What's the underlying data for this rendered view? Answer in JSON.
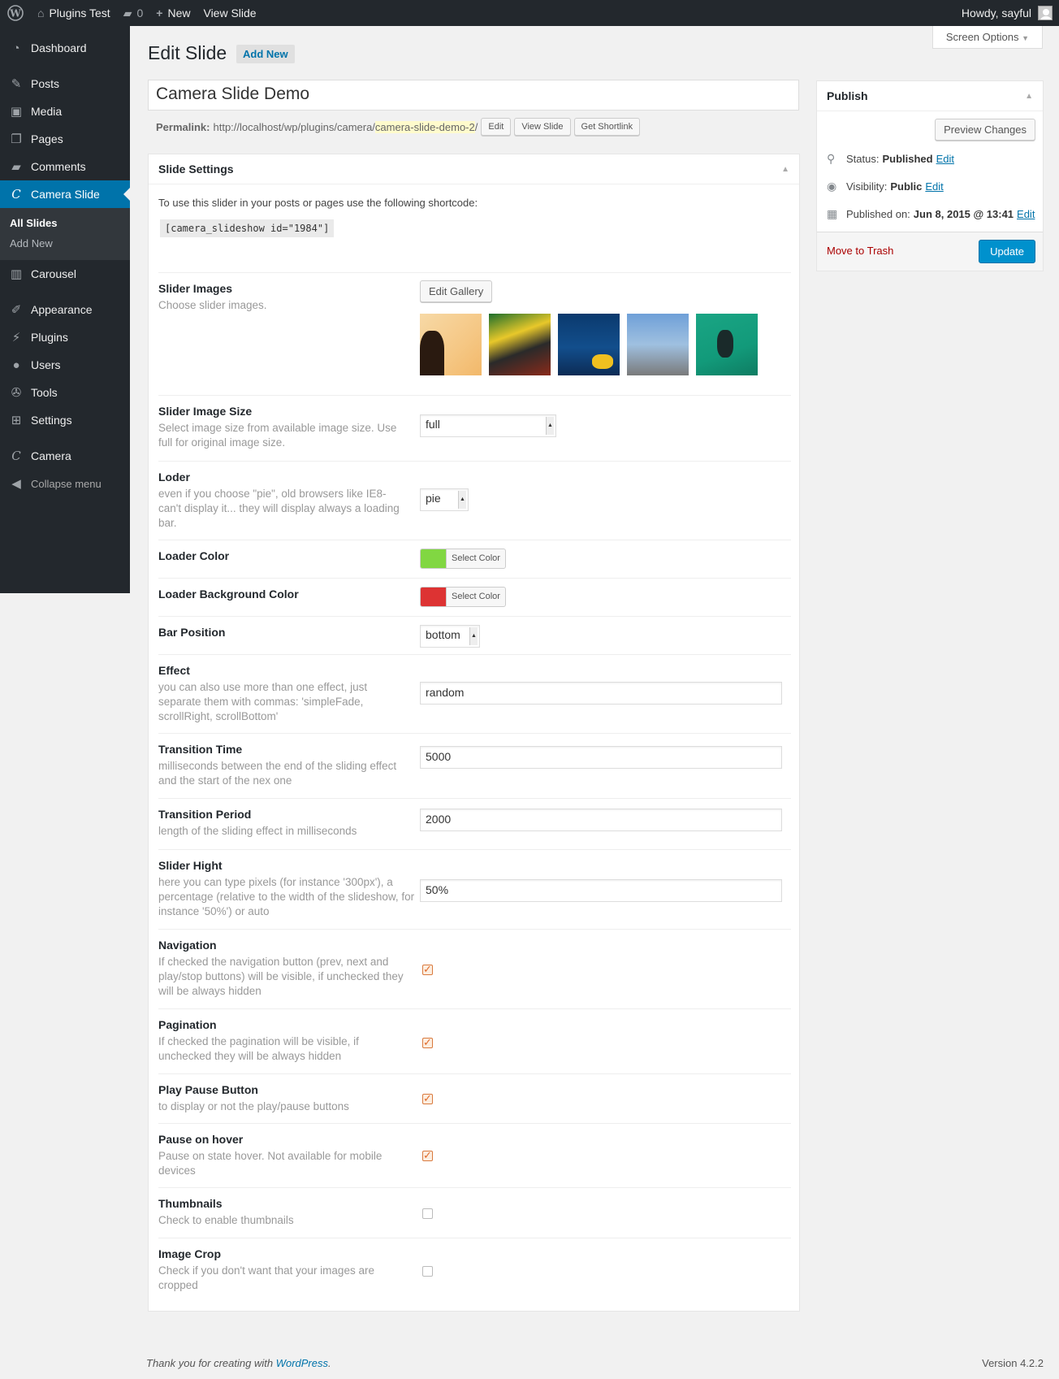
{
  "adminbar": {
    "site_name": "Plugins Test",
    "comments_count": "0",
    "new_label": "New",
    "view_label": "View Slide",
    "howdy": "Howdy, sayful"
  },
  "menu": {
    "dashboard": "Dashboard",
    "posts": "Posts",
    "media": "Media",
    "pages": "Pages",
    "comments": "Comments",
    "camera_slide": "Camera Slide",
    "all_slides": "All Slides",
    "add_new": "Add New",
    "carousel": "Carousel",
    "appearance": "Appearance",
    "plugins": "Plugins",
    "users": "Users",
    "tools": "Tools",
    "settings": "Settings",
    "camera": "Camera",
    "collapse": "Collapse menu"
  },
  "screen_options": "Screen Options",
  "page": {
    "title": "Edit Slide",
    "add_new": "Add New",
    "post_title": "Camera Slide Demo",
    "permalink_label": "Permalink:",
    "permalink_base": "http://localhost/wp/plugins/camera/",
    "permalink_slug": "camera-slide-demo-2",
    "permalink_end": "/",
    "edit_btn": "Edit",
    "view_btn": "View Slide",
    "shortlink_btn": "Get Shortlink"
  },
  "settings": {
    "header": "Slide Settings",
    "intro": "To use this slider in your posts or pages use the following shortcode:",
    "shortcode": "[camera_slideshow id=\"1984\"]",
    "slider_images": {
      "label": "Slider Images",
      "desc": "Choose slider images.",
      "button": "Edit Gallery"
    },
    "image_size": {
      "label": "Slider Image Size",
      "desc": "Select image size from available image size. Use full for original image size.",
      "value": "full"
    },
    "loder": {
      "label": "Loder",
      "desc": "even if you choose \"pie\", old browsers like IE8- can't display it... they will display always a loading bar.",
      "value": "pie"
    },
    "loader_color": {
      "label": "Loader Color",
      "button": "Select Color",
      "color": "#81d742"
    },
    "loader_bg_color": {
      "label": "Loader Background Color",
      "button": "Select Color",
      "color": "#dd3333"
    },
    "bar_position": {
      "label": "Bar Position",
      "value": "bottom"
    },
    "effect": {
      "label": "Effect",
      "desc": "you can also use more than one effect, just separate them with commas: 'simpleFade, scrollRight, scrollBottom'",
      "value": "random"
    },
    "transition_time": {
      "label": "Transition Time",
      "desc": "milliseconds between the end of the sliding effect and the start of the nex one",
      "value": "5000"
    },
    "transition_period": {
      "label": "Transition Period",
      "desc": "length of the sliding effect in milliseconds",
      "value": "2000"
    },
    "slider_hight": {
      "label": "Slider Hight",
      "desc": "here you can type pixels (for instance '300px'), a percentage (relative to the width of the slideshow, for instance '50%') or auto",
      "value": "50%"
    },
    "navigation": {
      "label": "Navigation",
      "desc": "If checked the navigation button (prev, next and play/stop buttons) will be visible, if unchecked they will be always hidden",
      "checked": true
    },
    "pagination": {
      "label": "Pagination",
      "desc": "If checked the pagination will be visible, if unchecked they will be always hidden",
      "checked": true
    },
    "play_pause": {
      "label": "Play Pause Button",
      "desc": "to display or not the play/pause buttons",
      "checked": true
    },
    "pause_hover": {
      "label": "Pause on hover",
      "desc": "Pause on state hover. Not available for mobile devices",
      "checked": true
    },
    "thumbnails": {
      "label": "Thumbnails",
      "desc": "Check to enable thumbnails",
      "checked": false
    },
    "image_crop": {
      "label": "Image Crop",
      "desc": "Check if you don't want that your images are cropped",
      "checked": false
    }
  },
  "publish": {
    "header": "Publish",
    "preview": "Preview Changes",
    "status_label": "Status:",
    "status_value": "Published",
    "visibility_label": "Visibility:",
    "visibility_value": "Public",
    "published_label": "Published on:",
    "published_value": "Jun 8, 2015 @ 13:41",
    "edit": "Edit",
    "trash": "Move to Trash",
    "update": "Update"
  },
  "footer": {
    "thanks_prefix": "Thank you for creating with ",
    "wordpress": "WordPress",
    "thanks_suffix": ".",
    "version": "Version 4.2.2"
  }
}
